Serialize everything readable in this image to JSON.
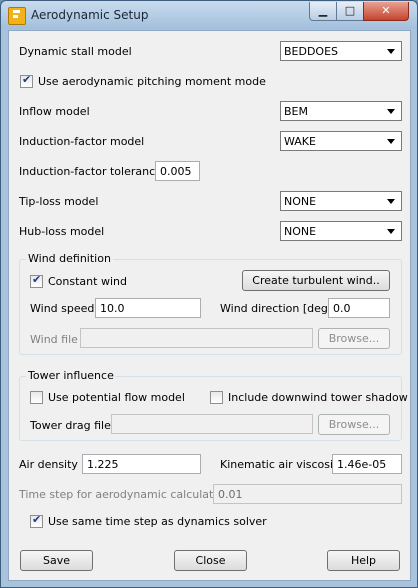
{
  "window": {
    "title": "Aerodynamic Setup",
    "minimize_glyph": "▁",
    "maximize_glyph": "□",
    "close_glyph": "✕",
    "icon": "app-icon"
  },
  "dynamic_stall": {
    "label": "Dynamic stall model",
    "value": "BEDDOES"
  },
  "pitching_moment": {
    "label": "Use aerodynamic pitching moment mode",
    "checked": true
  },
  "inflow": {
    "label": "Inflow model",
    "value": "BEM"
  },
  "induction_factor": {
    "label": "Induction-factor model",
    "value": "WAKE"
  },
  "induction_tolerance": {
    "label": "Induction-factor tolerance",
    "value": "0.005"
  },
  "tip_loss": {
    "label": "Tip-loss model",
    "value": "NONE"
  },
  "hub_loss": {
    "label": "Hub-loss model",
    "value": "NONE"
  },
  "wind": {
    "group_title": "Wind definition",
    "constant_wind_label": "Constant wind",
    "constant_wind_checked": true,
    "turbulent_button": "Create turbulent wind..",
    "speed_label": "Wind speed",
    "speed_value": "10.0",
    "direction_label": "Wind direction [deg]",
    "direction_value": "0.0",
    "file_label": "Wind file",
    "file_value": "",
    "browse_button": "Browse..."
  },
  "tower": {
    "group_title": "Tower influence",
    "potential_flow_label": "Use potential flow model",
    "potential_flow_checked": false,
    "downwind_shadow_label": "Include downwind tower shadow",
    "downwind_shadow_checked": false,
    "drag_file_label": "Tower drag file",
    "drag_file_value": "",
    "browse_button": "Browse..."
  },
  "air_density": {
    "label": "Air density",
    "value": "1.225"
  },
  "air_viscosity": {
    "label": "Kinematic air viscosity",
    "value": "1.46e-05"
  },
  "time_step": {
    "label": "Time step for aerodynamic calculations",
    "value": "0.01"
  },
  "same_time_step": {
    "label": "Use same time step as dynamics solver",
    "checked": true
  },
  "buttons": {
    "save": "Save",
    "close": "Close",
    "help": "Help"
  }
}
